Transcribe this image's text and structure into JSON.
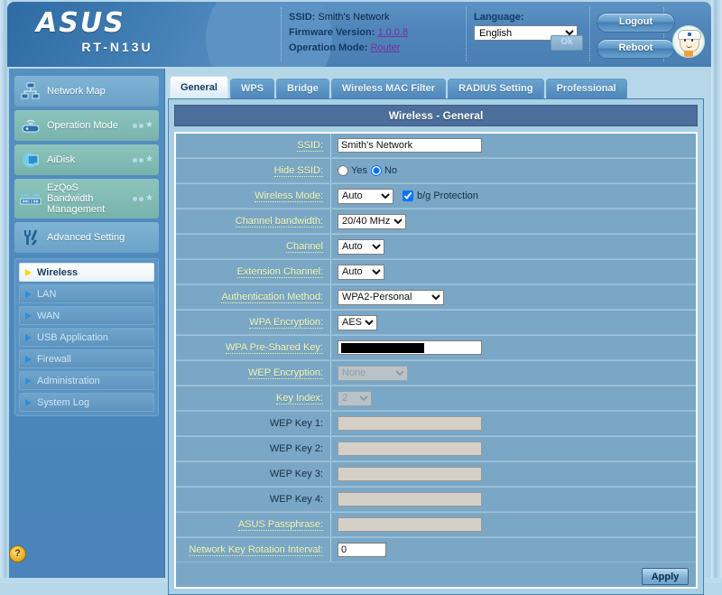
{
  "header": {
    "brand": "ASUS",
    "model": "RT-N13U",
    "ssid_label": "SSID:",
    "ssid_value": "Smith's Network",
    "firmware_label": "Firmware Version:",
    "firmware_value": "1.0.0.8",
    "opmode_label": "Operation Mode:",
    "opmode_value": "Router",
    "language_label": "Language:",
    "language_value": "English",
    "ok_label": "Ok",
    "logout_label": "Logout",
    "reboot_label": "Reboot",
    "mascot_icon": "asus-mascot-icon"
  },
  "sidebar": {
    "items": [
      {
        "label": "Network Map",
        "icon": "network-map-icon",
        "style": "blue",
        "badge": false
      },
      {
        "label": "Operation Mode",
        "icon": "operation-mode-icon",
        "style": "teal",
        "badge": true
      },
      {
        "label": "AiDisk",
        "icon": "aidisk-icon",
        "style": "teal",
        "badge": true
      },
      {
        "label": "EzQoS Bandwidth Management",
        "icon": "ezqos-icon",
        "style": "teal",
        "badge": true
      },
      {
        "label": "Advanced Setting",
        "icon": "advanced-setting-icon",
        "style": "blue",
        "badge": false
      }
    ],
    "submenu": [
      {
        "label": "Wireless",
        "active": true
      },
      {
        "label": "LAN",
        "active": false
      },
      {
        "label": "WAN",
        "active": false
      },
      {
        "label": "USB Application",
        "active": false
      },
      {
        "label": "Firewall",
        "active": false
      },
      {
        "label": "Administration",
        "active": false
      },
      {
        "label": "System Log",
        "active": false
      }
    ]
  },
  "main": {
    "tabs": [
      {
        "label": "General",
        "active": true
      },
      {
        "label": "WPS",
        "active": false
      },
      {
        "label": "Bridge",
        "active": false
      },
      {
        "label": "Wireless MAC Filter",
        "active": false
      },
      {
        "label": "RADIUS Setting",
        "active": false
      },
      {
        "label": "Professional",
        "active": false
      }
    ],
    "panel_title": "Wireless - General",
    "apply_label": "Apply",
    "fields": {
      "ssid_label": "SSID:",
      "ssid_value": "Smith's Network",
      "hide_ssid_label": "Hide SSID:",
      "hide_ssid_yes": "Yes",
      "hide_ssid_no": "No",
      "hide_ssid_selected": "No",
      "wireless_mode_label": "Wireless Mode:",
      "wireless_mode_value": "Auto",
      "bg_protection_label": "b/g Protection",
      "bg_protection_checked": true,
      "channel_bandwidth_label": "Channel bandwidth:",
      "channel_bandwidth_value": "20/40 MHz",
      "channel_label": "Channel",
      "channel_value": "Auto",
      "extension_channel_label": "Extension Channel:",
      "extension_channel_value": "Auto",
      "auth_method_label": "Authentication Method:",
      "auth_method_value": "WPA2-Personal",
      "wpa_encryption_label": "WPA Encryption:",
      "wpa_encryption_value": "AES",
      "wpa_psk_label": "WPA Pre-Shared Key:",
      "wpa_psk_value": "",
      "wep_encryption_label": "WEP Encryption:",
      "wep_encryption_value": "None",
      "key_index_label": "Key Index:",
      "key_index_value": "2",
      "wep_key1_label": "WEP Key 1:",
      "wep_key1_value": "",
      "wep_key2_label": "WEP Key 2:",
      "wep_key2_value": "",
      "wep_key3_label": "WEP Key 3:",
      "wep_key3_value": "",
      "wep_key4_label": "WEP Key 4:",
      "wep_key4_value": "",
      "passphrase_label": "ASUS Passphrase:",
      "passphrase_value": "",
      "rotation_label": "Network Key Rotation Interval:",
      "rotation_value": "0"
    }
  },
  "help": {
    "icon": "help-question-icon",
    "glyph": "?"
  }
}
